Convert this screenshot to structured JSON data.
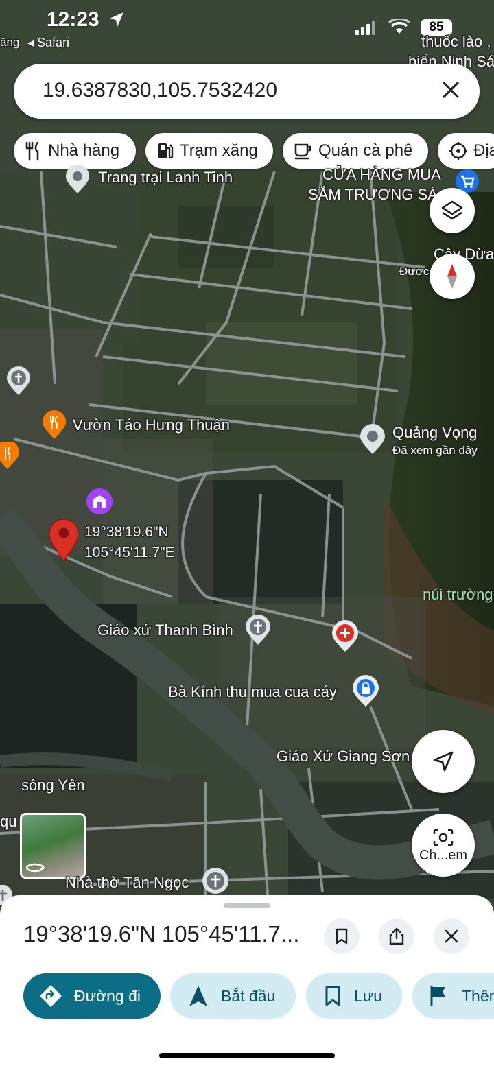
{
  "status_bar": {
    "time": "12:23",
    "back_app": "◂ Safari",
    "battery": "85"
  },
  "search": {
    "query": "19.6387830,105.7532420"
  },
  "chips": [
    {
      "label": "Nhà hàng",
      "icon": "restaurant-icon"
    },
    {
      "label": "Trạm xăng",
      "icon": "gas-station-icon"
    },
    {
      "label": "Quán cà phê",
      "icon": "coffee-icon"
    },
    {
      "label": "Địa",
      "icon": "attraction-icon"
    }
  ],
  "map": {
    "labels": {
      "top_right_1": "thuốc lào ,",
      "top_right_2": "biển Ninh Sá",
      "top_left": "ăng",
      "trang_trai": "Trang trại Lanh Tinh",
      "cua_hang_1": "CỬA HÀNG MUA",
      "cua_hang_2": "SẮM TRƯƠNG SÁ",
      "cay_dua": "Cây Dừa",
      "duoc": "Được",
      "vuon_tao": "Vườn Táo Hưng Thuận",
      "quang_vong": "Quảng Vọng",
      "recent": "Đã xem gần đây",
      "coord_lat": "19°38'19.6\"N",
      "coord_lng": "105°45'11.7\"E",
      "nui_truong": "núi trường",
      "giao_xu_thanh_binh": "Giáo xứ Thanh Bình",
      "ba_kinh": "Bà Kính thu mua cua cáy",
      "giao_xu_giang_son": "Giáo Xứ Giang Sơn",
      "song_yen": "sông Yên",
      "nha_tho_tan_ngoc": "Nhà thờ Tân Ngọc",
      "left_cut": "qu",
      "camera_label": "Ch...em"
    }
  },
  "sheet": {
    "title": "19°38'19.6\"N 105°45'11.7...",
    "actions": [
      {
        "label": "Đường đi",
        "icon": "directions-icon"
      },
      {
        "label": "Bắt đầu",
        "icon": "navigation-arrow-icon"
      },
      {
        "label": "Lưu",
        "icon": "bookmark-icon"
      },
      {
        "label": "Thêm",
        "icon": "flag-icon"
      }
    ]
  },
  "colors": {
    "accent": "#0b6e86",
    "pin": "#d93025",
    "action_bg": "#d3ecf4"
  }
}
